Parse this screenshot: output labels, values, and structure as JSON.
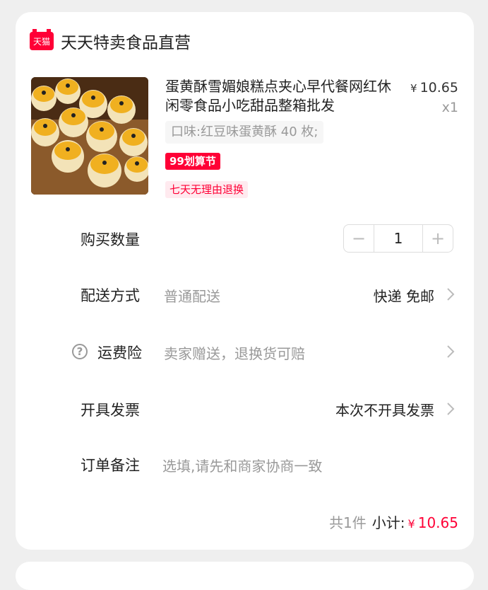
{
  "shop": {
    "logo_text": "天猫",
    "name": "天天特卖食品直营"
  },
  "product": {
    "title": "蛋黄酥雪媚娘糕点夹心早代餐网红休闲零食品小吃甜品整箱批发",
    "price_symbol": "¥",
    "price": "10.65",
    "quantity_label": "x1",
    "spec": "口味:红豆味蛋黄酥 40 枚;",
    "promo_tag": "99划算节",
    "return_tag": "七天无理由退换"
  },
  "rows": {
    "quantity": {
      "label": "购买数量",
      "minus": "−",
      "value": "1",
      "plus": "+"
    },
    "delivery": {
      "label": "配送方式",
      "sub": "普通配送",
      "value": "快递 免邮"
    },
    "insurance": {
      "help": "?",
      "label": "运费险",
      "sub": "卖家赠送，退换货可赔"
    },
    "invoice": {
      "label": "开具发票",
      "value": "本次不开具发票"
    },
    "note": {
      "label": "订单备注",
      "placeholder": "选填,请先和商家协商一致"
    }
  },
  "footer": {
    "count": "共1件",
    "subtotal_label": "小计:",
    "currency": "¥",
    "subtotal": "10.65"
  },
  "colors": {
    "accent": "#ff0036",
    "muted": "#999999"
  }
}
